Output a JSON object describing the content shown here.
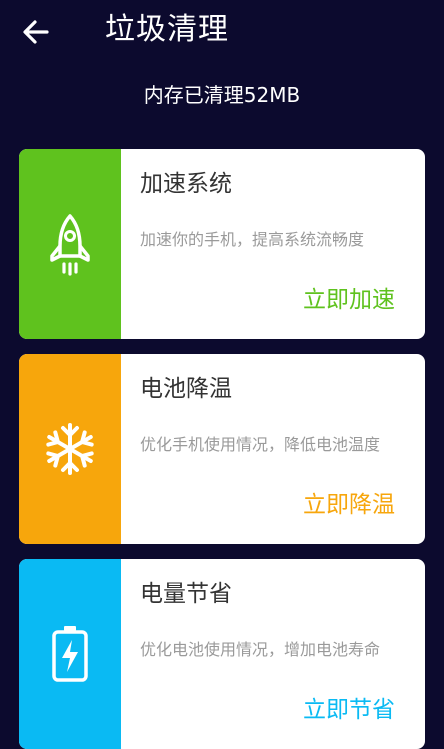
{
  "header": {
    "title": "垃圾清理",
    "memory_cleared": "内存已清理52MB"
  },
  "cards": [
    {
      "title": "加速系统",
      "description": "加速你的手机，提高系统流畅度",
      "action": "立即加速",
      "icon": "rocket-icon",
      "color": "#5fc21e"
    },
    {
      "title": "电池降温",
      "description": "优化手机使用情况，降低电池温度",
      "action": "立即降温",
      "icon": "snowflake-icon",
      "color": "#f7a60c"
    },
    {
      "title": "电量节省",
      "description": "优化电池使用情况，增加电池寿命",
      "action": "立即节省",
      "icon": "battery-charging-icon",
      "color": "#0abaf3"
    }
  ]
}
